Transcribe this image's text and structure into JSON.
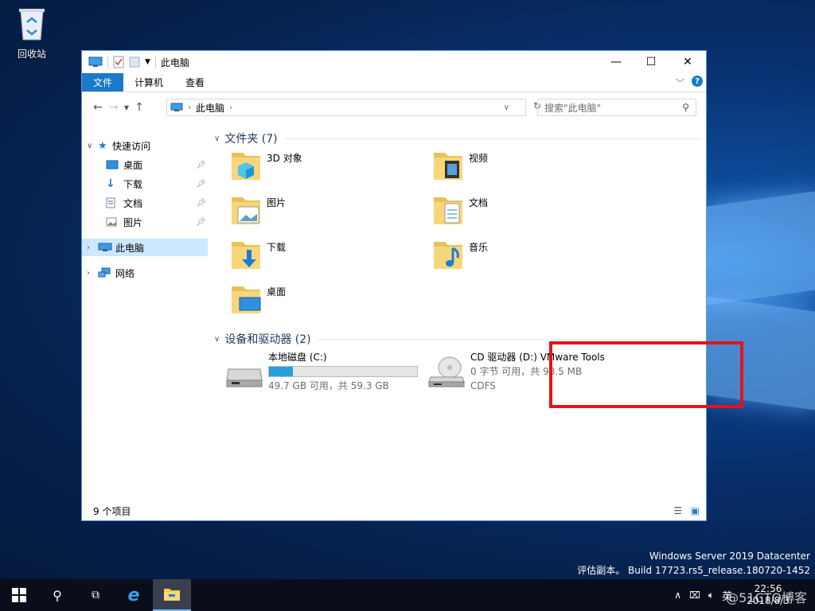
{
  "desktop": {
    "recycle_label": "回收站",
    "watermark_line1": "Windows Server 2019 Datacenter",
    "watermark_line2": "评估副本。 Build 17723.rs5_release.180720-1452"
  },
  "window": {
    "title": "此电脑",
    "controls": {
      "minimize": "—",
      "maximize": "☐",
      "close": "✕"
    }
  },
  "ribbon": {
    "tabs": [
      "文件",
      "计算机",
      "查看"
    ],
    "expand_icon": "chevron-down-icon",
    "help_icon": "?"
  },
  "address": {
    "path": "此电脑",
    "search_placeholder": "搜索\"此电脑\""
  },
  "nav": {
    "quick_access": "快速访问",
    "quick_items": [
      "桌面",
      "下载",
      "文档",
      "图片"
    ],
    "this_pc": "此电脑",
    "network": "网络"
  },
  "folders": {
    "header": "文件夹 (7)",
    "items": [
      "3D 对象",
      "视频",
      "图片",
      "文档",
      "下载",
      "音乐",
      "桌面"
    ]
  },
  "drives": {
    "header": "设备和驱动器 (2)",
    "c": {
      "name": "本地磁盘 (C:)",
      "space": "49.7 GB 可用，共 59.3 GB",
      "used_fraction": 0.162
    },
    "d": {
      "name": "CD 驱动器 (D:) VMware Tools",
      "space": "0 字节 可用，共 98.5 MB",
      "fs": "CDFS"
    }
  },
  "status": {
    "count": "9 个项目"
  },
  "taskbar": {
    "lang": "英",
    "time": "22:56",
    "date": "2018/8/3",
    "overlay": "@51CTO博客"
  },
  "colors": {
    "accent": "#1979ca",
    "highlight": "#e4141c",
    "bar_fill": "#26a0da"
  }
}
